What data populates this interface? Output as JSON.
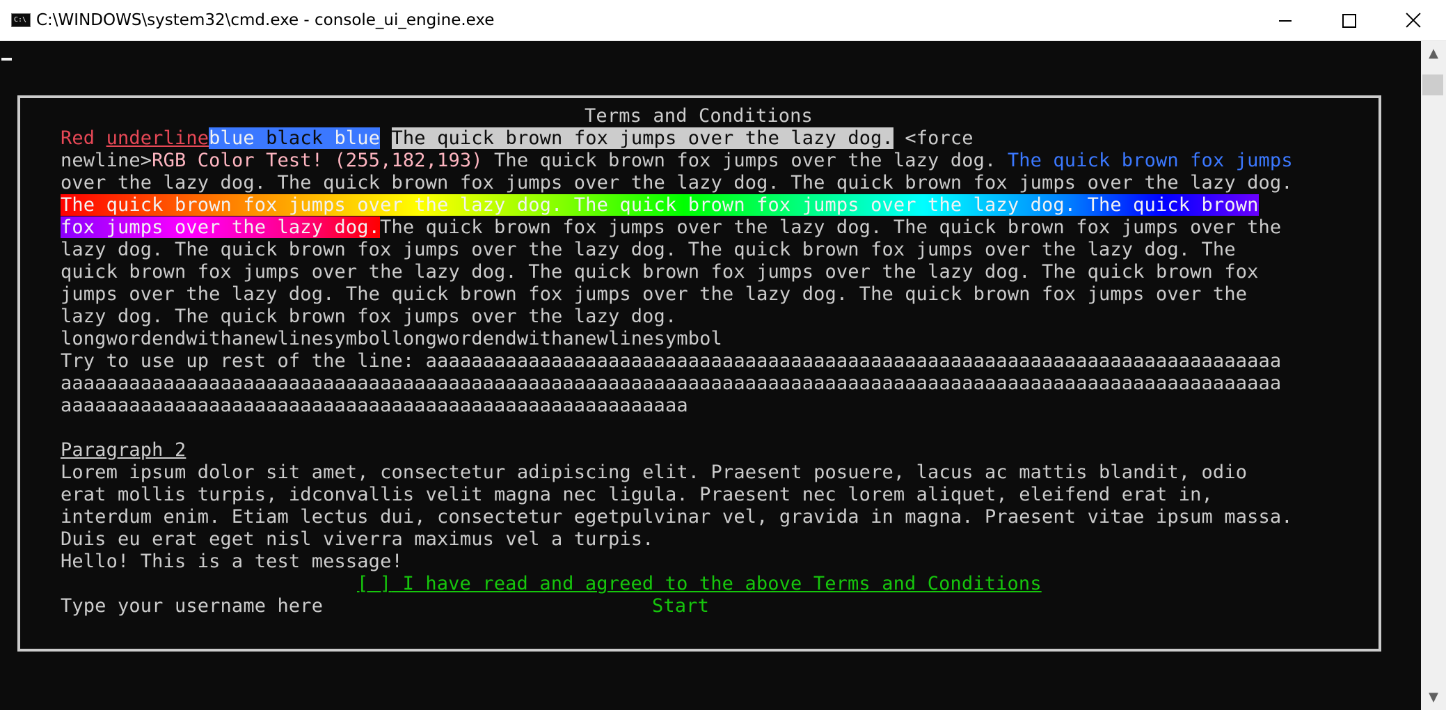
{
  "window": {
    "title": "C:\\WINDOWS\\system32\\cmd.exe - console_ui_engine.exe",
    "icon": "C:\\",
    "minimize_icon": "minimize-icon",
    "maximize_icon": "maximize-icon",
    "close_icon": "close-icon"
  },
  "dialog": {
    "title": "Terms and Conditions",
    "line1": {
      "red": "Red ",
      "underline": "underline",
      "blue1": "blue ",
      "black": "black",
      "blue2": " blue",
      "space": " ",
      "highlight": "The quick brown fox jumps over the lazy dog.",
      "rest": " <force"
    },
    "line2": {
      "plain": "newline>",
      "pink": "RGB Color Test! (255,182,193)",
      "mid": " The quick brown fox jumps over the lazy dog. ",
      "blue": "The quick brown fox jumps"
    },
    "line3": "over the lazy dog. The quick brown fox jumps over the lazy dog. The quick brown fox jumps over the lazy dog.",
    "line4_rainbow": "The quick brown fox jumps over the lazy dog. The quick brown fox jumps over the lazy dog. The quick brown",
    "line5": {
      "rainbow": "fox jumps over the lazy dog.",
      "rest": "The quick brown fox jumps over the lazy dog. The quick brown fox jumps over the"
    },
    "line6": "lazy dog. The quick brown fox jumps over the lazy dog. The quick brown fox jumps over the lazy dog. The",
    "line7": "quick brown fox jumps over the lazy dog. The quick brown fox jumps over the lazy dog. The quick brown fox",
    "line8": "jumps over the lazy dog. The quick brown fox jumps over the lazy dog. The quick brown fox jumps over the",
    "line9": "lazy dog. The quick brown fox jumps over the lazy dog.",
    "line10": "longwordendwithanewlinesymbollongwordendwithanewlinesymbol",
    "line11": "Try to use up rest of the line: aaaaaaaaaaaaaaaaaaaaaaaaaaaaaaaaaaaaaaaaaaaaaaaaaaaaaaaaaaaaaaaaaaaaaaaaaaa",
    "line12": "aaaaaaaaaaaaaaaaaaaaaaaaaaaaaaaaaaaaaaaaaaaaaaaaaaaaaaaaaaaaaaaaaaaaaaaaaaaaaaaaaaaaaaaaaaaaaaaaaaaaaaaaaaa",
    "line13": "aaaaaaaaaaaaaaaaaaaaaaaaaaaaaaaaaaaaaaaaaaaaaaaaaaaaaaa",
    "paragraph2_heading": "Paragraph 2",
    "p2_line1": "Lorem ipsum dolor sit amet, consectetur adipiscing elit. Praesent posuere, lacus ac mattis blandit, odio",
    "p2_line2": "erat mollis turpis, idconvallis velit magna nec ligula. Praesent nec lorem aliquet, eleifend erat in,",
    "p2_line3": "interdum enim. Etiam lectus dui, consectetur egetpulvinar vel, gravida in magna. Praesent vitae ipsum massa.",
    "p2_line4": "Duis eu erat eget nisl viverra maximus vel a turpis.",
    "message": "Hello! This is a test message!",
    "checkbox": {
      "box": "[ ]",
      "label": " I have read and agreed to the above Terms and Conditions"
    },
    "username_placeholder": "Type your username here",
    "start_button": "Start"
  },
  "colors": {
    "console_bg": "#0c0c0c",
    "text": "#cccccc",
    "red": "#e74856",
    "blue": "#3b78ff",
    "pink": "#ffb6c1",
    "green": "#16c60c",
    "frame": "#cccccc"
  },
  "scrollbar": {
    "up_icon": "scroll-up-arrow-icon",
    "down_icon": "scroll-down-arrow-icon",
    "up_glyph": "▲",
    "down_glyph": "▼"
  }
}
